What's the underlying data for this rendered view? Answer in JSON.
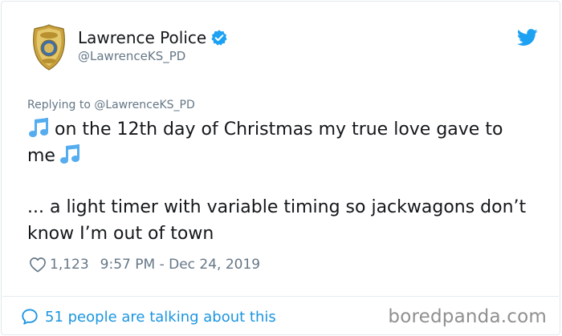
{
  "author": {
    "name": "Lawrence Police",
    "handle": "@LawrenceKS_PD",
    "verified": true
  },
  "reply_to": "Replying to @LawrenceKS_PD",
  "tweet": {
    "line1": "on the 12th day of Christmas my true love gave to me",
    "line2": "... a light timer with variable timing so jackwagons don’t know I’m out of town"
  },
  "meta": {
    "likes": "1,123",
    "timestamp": "9:57 PM - Dec 24, 2019"
  },
  "footer": {
    "talking": "51 people are talking about this",
    "watermark": "boredpanda.com"
  },
  "icons": [
    "police-badge-icon",
    "verified-icon",
    "twitter-bird-icon",
    "music-notes-icon",
    "heart-icon",
    "speech-bubble-icon"
  ],
  "colors": {
    "accent": "#1b95e0",
    "secondary_text": "#657786",
    "verified": "#1da1f2",
    "emoji_blue": "#55acee"
  }
}
